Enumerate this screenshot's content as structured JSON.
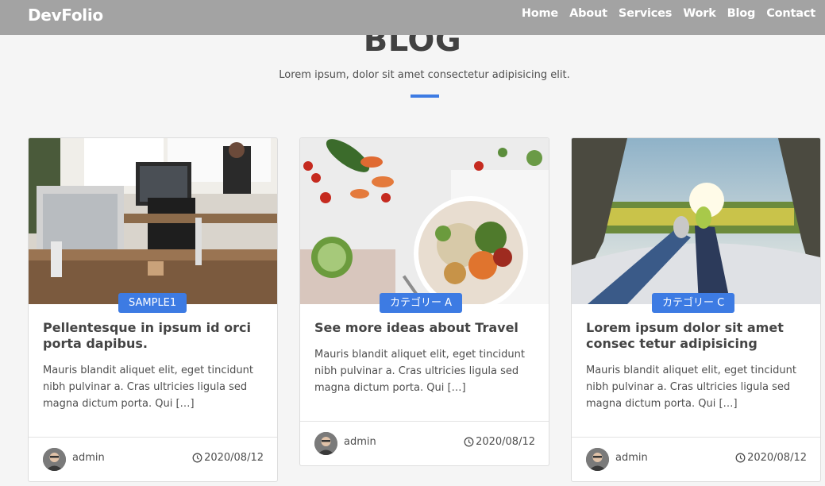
{
  "brand": "DevFolio",
  "nav": [
    "Home",
    "About",
    "Services",
    "Work",
    "Blog",
    "Contact"
  ],
  "section": {
    "title": "BLOG",
    "subtitle": "Lorem ipsum, dolor sit amet consectetur adipisicing elit."
  },
  "colors": {
    "accent": "#3d7be3",
    "header_bg": "#a3a3a3",
    "page_bg": "#f5f5f5"
  },
  "cards": [
    {
      "category": "SAMPLE1",
      "title": "Pellentesque in ipsum id orci porta dapibus.",
      "excerpt": "Mauris blandit aliquet elit, eget tincidunt nibh pulvinar a. Cras ultricies ligula sed magna dictum porta. Qui […]",
      "author": "admin",
      "date": "2020/08/12",
      "image": "office-desk-photo"
    },
    {
      "category": "カテゴリー A",
      "title": "See more ideas about Travel",
      "excerpt": "Mauris blandit aliquet elit, eget tincidunt nibh pulvinar a. Cras ultricies ligula sed magna dictum porta. Qui […]",
      "author": "admin",
      "date": "2020/08/12",
      "image": "food-bowl-photo"
    },
    {
      "category": "カテゴリー C",
      "title": "Lorem ipsum dolor sit amet consec tetur adipisicing",
      "excerpt": "Mauris blandit aliquet elit, eget tincidunt nibh pulvinar a. Cras ultricies ligula sed magna dictum porta. Qui […]",
      "author": "admin",
      "date": "2020/08/12",
      "image": "tent-view-photo"
    }
  ]
}
